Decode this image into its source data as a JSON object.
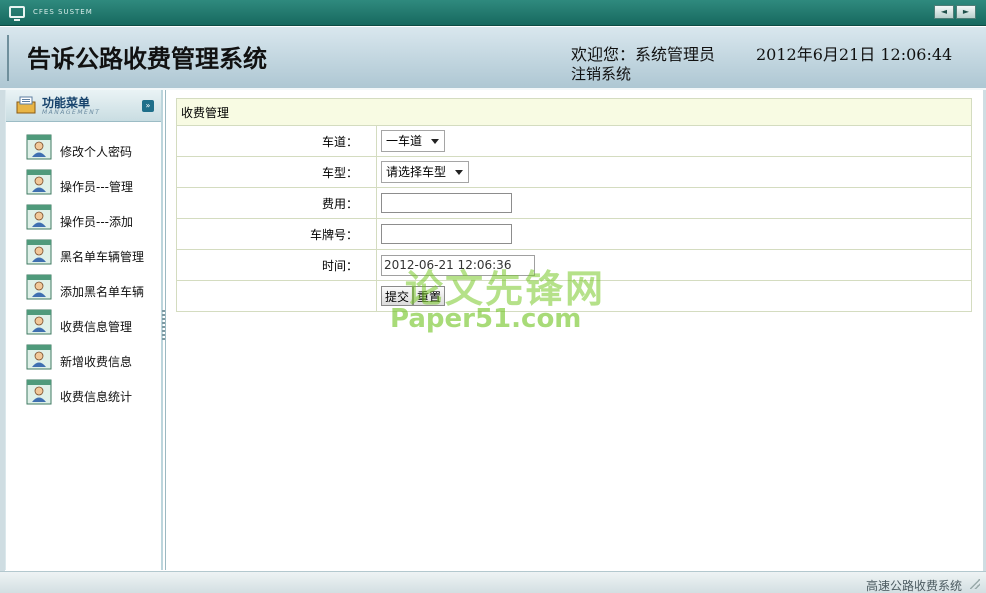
{
  "window": {
    "system_label": "CFES SUSTEM",
    "nav_prev": "◄",
    "nav_next": "►"
  },
  "header": {
    "title": "告诉公路收费管理系统",
    "welcome": "欢迎您：系统管理员",
    "datetime": "2012年6月21日  12:06:44",
    "logout": "注销系统"
  },
  "sidebar": {
    "title": "功能菜单",
    "subtitle": "MANAGEMENT",
    "collapse_icon": "chevron-double-down-icon",
    "items": [
      {
        "label": "修改个人密码",
        "icon": "user-card-icon"
      },
      {
        "label": "操作员---管理",
        "icon": "user-card-icon"
      },
      {
        "label": "操作员---添加",
        "icon": "user-card-icon"
      },
      {
        "label": "黑名单车辆管理",
        "icon": "user-card-icon"
      },
      {
        "label": "添加黑名单车辆",
        "icon": "user-card-icon"
      },
      {
        "label": "收费信息管理",
        "icon": "user-card-icon"
      },
      {
        "label": "新增收费信息",
        "icon": "user-card-icon"
      },
      {
        "label": "收费信息统计",
        "icon": "user-card-icon"
      }
    ]
  },
  "form": {
    "caption": "收费管理",
    "lane_label": "车道：",
    "lane_value": "一车道",
    "vehicle_type_label": "车型：",
    "vehicle_type_value": "请选择车型",
    "fee_label": "费用：",
    "fee_value": "",
    "plate_label": "车牌号：",
    "plate_value": "",
    "time_label": "时间：",
    "time_value": "2012-06-21 12:06:36",
    "submit_label": "提交",
    "reset_label": "重置"
  },
  "watermark": {
    "cn": "论文先锋网",
    "en": "Paper51.com"
  },
  "status": {
    "text": "高速公路收费系统"
  },
  "colors": {
    "titlebar": "#1f7a6e",
    "header_bg": "#c3d8e1",
    "caption_bg": "#f8fbe3",
    "watermark": "#78c828"
  }
}
